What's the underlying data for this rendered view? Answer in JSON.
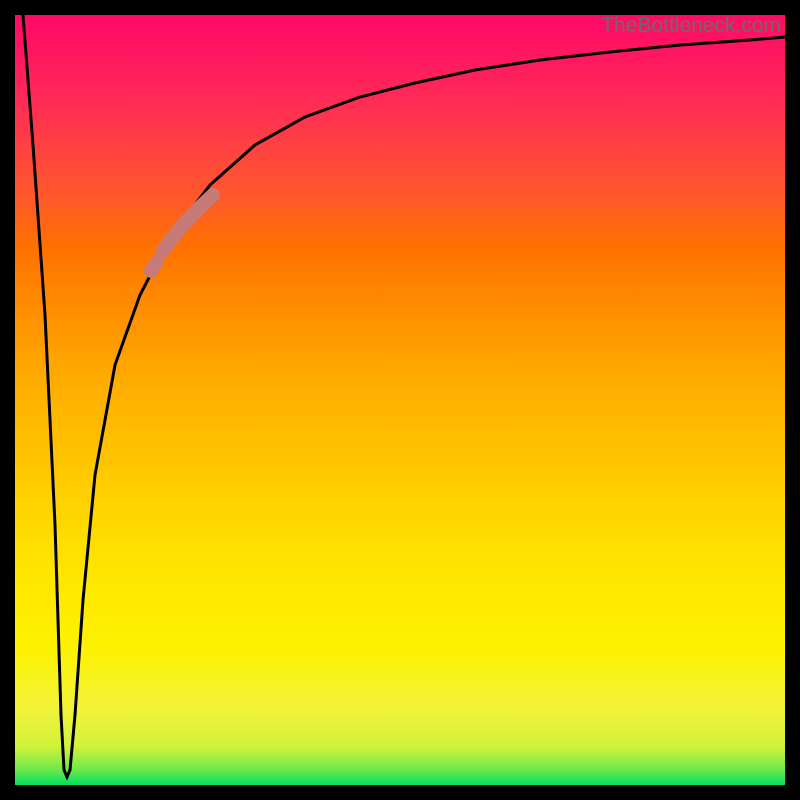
{
  "watermark": "TheBottleneck.com",
  "chart_data": {
    "type": "line",
    "title": "",
    "xlabel": "",
    "ylabel": "",
    "xlim": [
      0,
      100
    ],
    "ylim": [
      0,
      100
    ],
    "grid": false,
    "legend": false,
    "note": "No numeric axis ticks or data labels are rendered in the source image. The curve, thick highlight segment, and background gradient are the only visible plot elements.",
    "series": [
      {
        "name": "bottleneck-curve",
        "description": "Black curve: starts at top-left, dives sharply to near-zero around x≈6, then rises asymptotically toward ~97% at the right edge.",
        "x": [
          0,
          2,
          4,
          5.5,
          6,
          6.5,
          8,
          10,
          13,
          16,
          20,
          25,
          30,
          35,
          40,
          45,
          50,
          60,
          70,
          80,
          90,
          100
        ],
        "y": [
          100,
          65,
          30,
          6,
          1,
          6,
          24,
          40,
          55,
          64,
          72,
          79,
          83,
          86,
          88,
          90,
          91.5,
          93.5,
          95,
          96,
          96.8,
          97.4
        ]
      },
      {
        "name": "highlight-segment",
        "description": "Thick muted-rose stroke overlaid on the rising portion of the curve, roughly x 16→23, with a small detached dot just below the main segment.",
        "x": [
          16,
          18,
          20,
          22,
          23
        ],
        "y": [
          64,
          68,
          72,
          75,
          77
        ]
      }
    ],
    "colors": {
      "curve": "#000000",
      "highlight": "#c77b78",
      "gradient_top": "#ff0a66",
      "gradient_mid": "#fef200",
      "gradient_bottom": "#00e060",
      "frame": "#000000",
      "watermark": "#6b6b6b"
    }
  }
}
